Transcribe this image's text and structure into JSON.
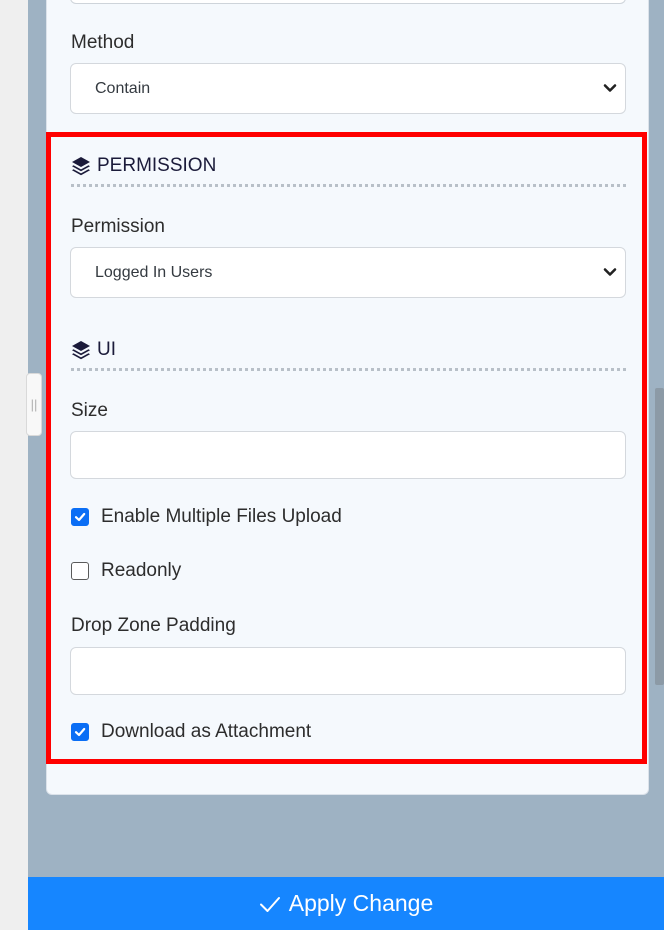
{
  "method": {
    "label": "Method",
    "value": "Contain"
  },
  "permission_section": {
    "heading": "PERMISSION",
    "field_label": "Permission",
    "value": "Logged In Users"
  },
  "ui_section": {
    "heading": "UI",
    "size_label": "Size",
    "size_value": "",
    "enable_multiple_label": "Enable Multiple Files Upload",
    "enable_multiple_checked": true,
    "readonly_label": "Readonly",
    "readonly_checked": false,
    "drop_zone_label": "Drop Zone Padding",
    "drop_zone_value": "",
    "download_label": "Download as Attachment",
    "download_checked": true
  },
  "apply_button": {
    "label": "Apply Change"
  },
  "colors": {
    "highlight": "#ff0000",
    "accent": "#1686ff",
    "checkbox": "#0a6ef5",
    "backdrop": "#9eb2c3"
  },
  "icons": {
    "section": "layers-icon",
    "select_arrow": "chevron-down-icon",
    "apply": "check-icon",
    "handle": "grip-icon"
  }
}
